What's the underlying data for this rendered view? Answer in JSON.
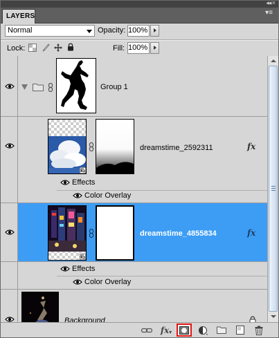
{
  "panel": {
    "tab_label": "LAYERS",
    "collapse_glyph": "◂◂ ×",
    "menu_glyph": "▾≡"
  },
  "controls": {
    "blend_mode": "Normal",
    "opacity_label": "Opacity:",
    "opacity_value": "100%",
    "lock_label": "Lock:",
    "fill_label": "Fill:",
    "fill_value": "100%"
  },
  "layers": [
    {
      "name": "Group 1",
      "type": "group",
      "visible": true
    },
    {
      "name": "dreamstime_2592311",
      "type": "smart-object-with-mask",
      "visible": true,
      "has_fx": true,
      "effects_label": "Effects",
      "effect": "Color Overlay"
    },
    {
      "name": "dreamstime_4855834",
      "type": "smart-object-with-mask",
      "visible": true,
      "selected": true,
      "has_fx": true,
      "effects_label": "Effects",
      "effect": "Color Overlay"
    },
    {
      "name": "Background",
      "type": "background",
      "visible": true,
      "locked": true
    }
  ],
  "toolbar": {
    "fx_label": "fx",
    "icons": [
      "link-layers-icon",
      "layer-style-icon",
      "add-mask-icon",
      "adjustment-layer-icon",
      "new-group-icon",
      "new-layer-icon",
      "delete-layer-icon"
    ]
  },
  "colors": {
    "selection": "#3d9df5",
    "panel_bg": "#d6d6d6",
    "highlight_outline": "#e01818"
  }
}
